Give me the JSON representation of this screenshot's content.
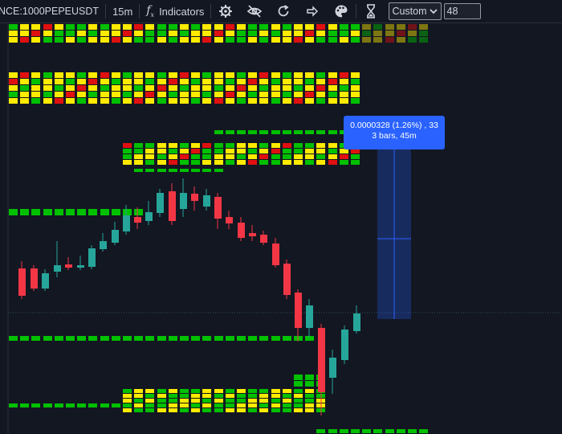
{
  "toolbar": {
    "symbol": "NCE:1000PEPEUSDT",
    "interval": "15m",
    "indicators_label": "Indicators",
    "indicators_icon": "function-icon",
    "tool_icons": [
      "settings-gear-icon",
      "hide-eye-icon",
      "reload-icon",
      "forward-arrow-icon",
      "palette-icon",
      "hourglass-icon"
    ],
    "range_select": "Custom",
    "range_value": "48"
  },
  "measure_tooltip": {
    "line1": "0.0000328 (1.26%) , 33",
    "line2": "3 bars, 45m"
  },
  "colors": {
    "background": "#131722",
    "up": "#26a69a",
    "down": "#f23645",
    "heat_green": "#00c000",
    "heat_yellow": "#ffeb00",
    "heat_red": "#e01010",
    "measure_fill": "#2962ff",
    "crosshair": "#2962ff"
  }
}
